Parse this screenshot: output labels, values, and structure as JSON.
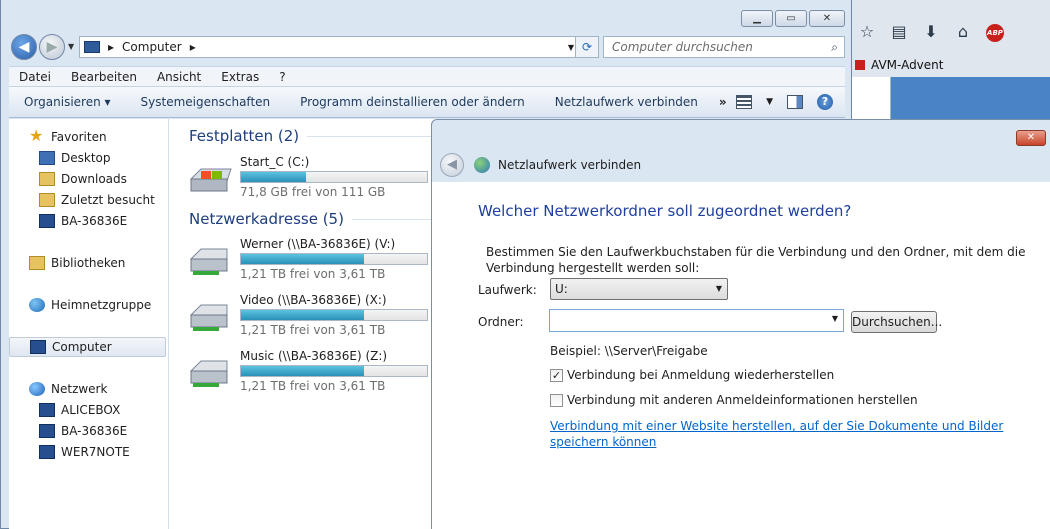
{
  "browser": {
    "bookmark": "AVM-Advent",
    "abp_label": "ABP",
    "icons": [
      "star-icon",
      "clipboard-icon",
      "download-icon",
      "home-icon",
      "adblock-icon"
    ]
  },
  "explorer": {
    "caption": {
      "minimize": "▭",
      "maximize": "▭",
      "close": "✕"
    },
    "nav": {
      "back": "◀",
      "forward": "▶",
      "refresh": "⟳"
    },
    "address": {
      "path": "Computer",
      "sep": "▸"
    },
    "search_placeholder": "Computer durchsuchen",
    "menu": [
      "Datei",
      "Bearbeiten",
      "Ansicht",
      "Extras",
      "?"
    ],
    "commands": {
      "organize": "Organisieren ▾",
      "system_properties": "Systemeigenschaften",
      "uninstall": "Programm deinstallieren oder ändern",
      "map_drive": "Netzlaufwerk verbinden",
      "more": "»"
    },
    "navpane": {
      "favorites": "Favoriten",
      "desktop": "Desktop",
      "downloads": "Downloads",
      "recent": "Zuletzt besucht",
      "ba": "BA-36836E",
      "libraries": "Bibliotheken",
      "homegroup": "Heimnetzgruppe",
      "computer": "Computer",
      "network": "Netzwerk",
      "net_items": [
        "ALICEBOX",
        "BA-36836E",
        "WER7NOTE"
      ]
    },
    "groups": {
      "hdd": "Festplatten (2)",
      "net": "Netzwerkadresse (5)"
    },
    "drives": [
      {
        "name": "Start_C (C:)",
        "free": "71,8 GB frei von 111 GB",
        "used_fraction": 0.35
      },
      {
        "name": "Werner (\\\\BA-36836E) (V:)",
        "free": "1,21 TB frei von 3,61 TB",
        "used_fraction": 0.66
      },
      {
        "name": "Video (\\\\BA-36836E) (X:)",
        "free": "1,21 TB frei von 3,61 TB",
        "used_fraction": 0.66
      },
      {
        "name": "Music (\\\\BA-36836E) (Z:)",
        "free": "1,21 TB frei von 3,61 TB",
        "used_fraction": 0.66
      }
    ]
  },
  "dialog": {
    "close": "✕",
    "title": "Netzlaufwerk verbinden",
    "heading": "Welcher Netzwerkordner soll zugeordnet werden?",
    "instructions": "Bestimmen Sie den Laufwerkbuchstaben für die Verbindung und den Ordner, mit dem die Verbindung hergestellt werden soll:",
    "drive_label": "Laufwerk:",
    "drive_value": "U:",
    "folder_label": "Ordner:",
    "folder_value": "",
    "browse": "Durchsuchen...",
    "example": "Beispiel: \\\\Server\\Freigabe",
    "reconnect": {
      "label": "Verbindung bei Anmeldung wiederherstellen",
      "checked": true
    },
    "other_creds": {
      "label": "Verbindung mit anderen Anmeldeinformationen herstellen",
      "checked": false
    },
    "website_link": "Verbindung mit einer Website herstellen, auf der Sie Dokumente und Bilder speichern können"
  }
}
